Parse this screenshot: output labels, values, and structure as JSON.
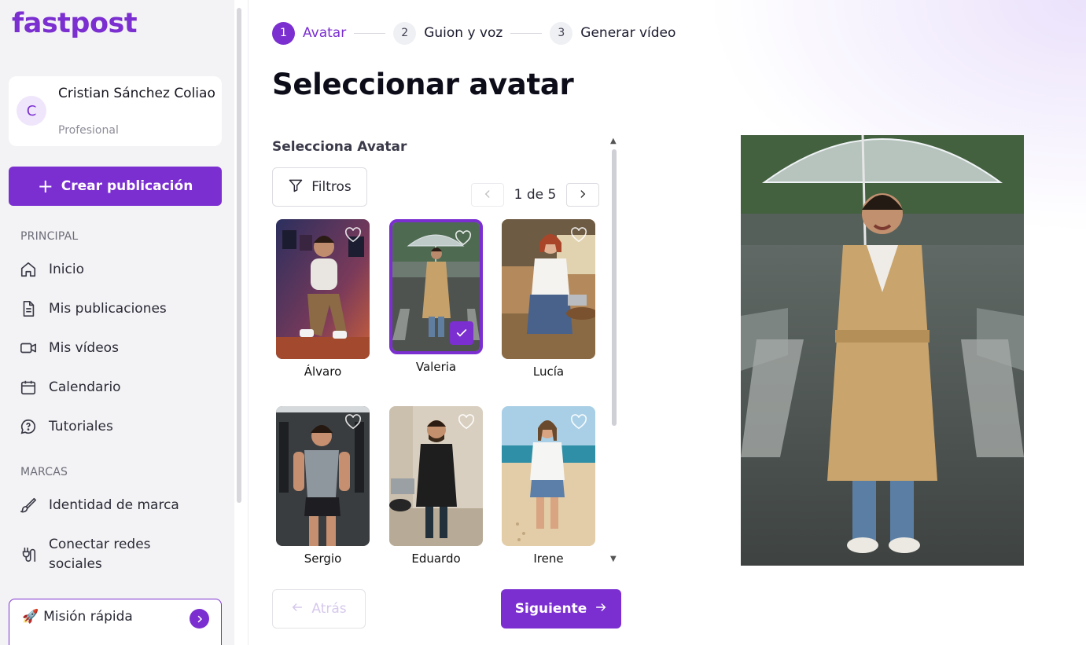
{
  "sidebar": {
    "logo": "fastpost",
    "user": {
      "initial": "C",
      "name": "Cristian Sánchez Coliao",
      "plan": "Profesional"
    },
    "create_label": "Crear publicación",
    "sections": {
      "principal": "PRINCIPAL",
      "marcas": "MARCAS"
    },
    "nav": [
      {
        "label": "Inicio",
        "icon": "home-icon"
      },
      {
        "label": "Mis publicaciones",
        "icon": "document-icon"
      },
      {
        "label": "Mis vídeos",
        "icon": "video-camera-icon"
      },
      {
        "label": "Calendario",
        "icon": "calendar-icon"
      },
      {
        "label": "Tutoriales",
        "icon": "help-chat-icon"
      }
    ],
    "brand_nav": [
      {
        "label": "Identidad de marca",
        "icon": "brush-icon"
      },
      {
        "label": "Conectar redes sociales",
        "icon": "plug-icon"
      }
    ],
    "mission": {
      "label": "Misión rápida",
      "icon": "rocket-icon"
    }
  },
  "stepper": [
    {
      "num": "1",
      "label": "Avatar",
      "active": true
    },
    {
      "num": "2",
      "label": "Guion y voz",
      "active": false
    },
    {
      "num": "3",
      "label": "Generar vídeo",
      "active": false
    }
  ],
  "main": {
    "title": "Seleccionar avatar",
    "panel_title": "Selecciona Avatar",
    "filter_label": "Filtros",
    "pager_text": "1 de 5",
    "back_label": "Atrás",
    "next_label": "Siguiente"
  },
  "avatars": [
    {
      "name": "Álvaro",
      "selected": false
    },
    {
      "name": "Valeria",
      "selected": true
    },
    {
      "name": "Lucía",
      "selected": false
    },
    {
      "name": "Sergio",
      "selected": false
    },
    {
      "name": "Eduardo",
      "selected": false
    },
    {
      "name": "Irene",
      "selected": false
    }
  ],
  "colors": {
    "accent": "#7b2fd0",
    "sidebar_bg": "#f3f3f5"
  }
}
